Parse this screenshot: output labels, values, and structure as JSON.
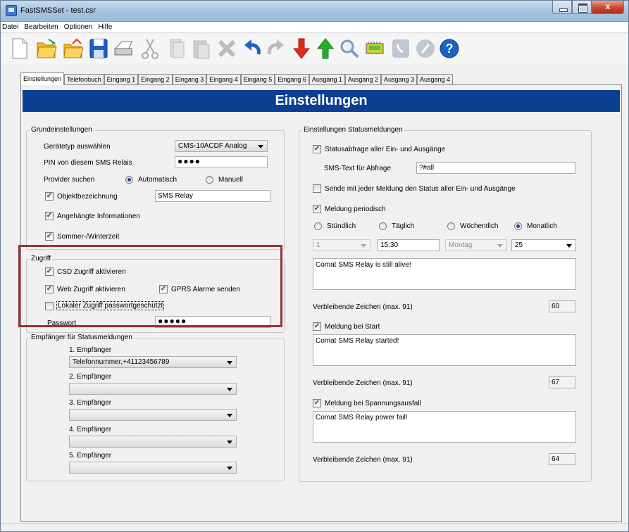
{
  "window": {
    "title": "FastSMSSet - test.csr",
    "close_glyph": "x"
  },
  "menu": [
    "Datei",
    "Bearbeiten",
    "Optionen",
    "Hilfe"
  ],
  "toolbar": [
    "new-icon",
    "open-icon",
    "open-alt-icon",
    "save-icon",
    "print-icon",
    "cut-icon",
    "copy-icon",
    "paste-icon",
    "delete-icon",
    "undo-icon",
    "redo-icon",
    "download-icon",
    "upload-icon",
    "search-icon",
    "device-icon",
    "phone-icon",
    "call-icon",
    "help-icon"
  ],
  "tabs": [
    "Einstellungen",
    "Telefonbuch",
    "Eingang 1",
    "Eingang 2",
    "Eingang 3",
    "Eingang 4",
    "Eingang 5",
    "Eingang 6",
    "Ausgang 1",
    "Ausgang 2",
    "Ausgang 3",
    "Ausgang 4"
  ],
  "banner": "Einstellungen",
  "grund": {
    "title": "Grundeinstellungen",
    "device_label": "Gerätetyp auswählen",
    "device_value": "CMS-10ACDF Analog",
    "pin_label": "PIN von diesem SMS Relais",
    "pin_value": "●●●●",
    "provider_label": "Provider suchen",
    "provider_auto": "Automatisch",
    "provider_manual": "Manuell",
    "objekt_label": "Objektbezeichnung",
    "objekt_value": "SMS Relay",
    "info_label": "Angehängte Informationen",
    "sommer_label": "Sommer-/Winterzeit"
  },
  "zugriff": {
    "title": "Zugriff",
    "csd_label": "CSD Zugriff aktivieren",
    "web_label": "Web Zugriff aktivieren",
    "gprs_label": "GPRS Alarme senden",
    "lokal_label": "Lokaler Zugriff passwortgeschützt",
    "pass_label": "Passwort",
    "pass_value": "●●●●●"
  },
  "empf": {
    "title": "Empfänger für Statusmeldungen",
    "items": [
      {
        "label": "1. Empfänger",
        "value": "Telefonnummer,+41123456789"
      },
      {
        "label": "2. Empfänger",
        "value": ""
      },
      {
        "label": "3. Empfänger",
        "value": ""
      },
      {
        "label": "4. Empfänger",
        "value": ""
      },
      {
        "label": "5. Empfänger",
        "value": ""
      }
    ]
  },
  "status": {
    "title": "Einstellungen Statusmeldungen",
    "abfrage_label": "Statusabfrage aller Ein- und Ausgänge",
    "smstext_label": "SMS-Text für Abfrage",
    "smstext_value": "?#all",
    "sende_label": "Sende mit jeder Meldung den Status aller Ein- und Ausgänge",
    "periodisch_label": "Meldung periodisch",
    "r_std": "Stündlich",
    "r_tag": "Täglich",
    "r_woche": "Wöchentlich",
    "r_monat": "Monatlich",
    "p_hour": "1",
    "p_time": "15:30",
    "p_day": "Montag",
    "p_date": "25",
    "msg1": "Comat SMS Relay is still alive!",
    "rest_label": "Verbleibende Zeichen (max. 91)",
    "rest1": "60",
    "start_label": "Meldung bei Start",
    "msg2": "Comat SMS Relay started!",
    "rest2": "67",
    "spannung_label": "Meldung bei Spannungsausfall",
    "msg3": "Comat SMS Relay power fail!",
    "rest3": "64"
  },
  "colors": {
    "banner": "#0a3f93",
    "highlight": "#993333"
  }
}
